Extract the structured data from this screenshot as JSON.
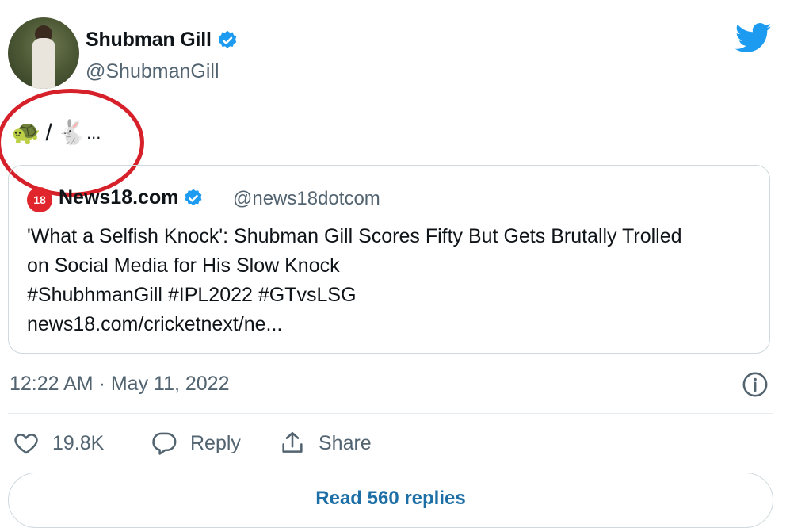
{
  "author": {
    "name": "Shubman Gill",
    "handle": "@ShubmanGill"
  },
  "tweet": {
    "emoji_turtle": "🐢",
    "slash": "/",
    "emoji_rabbit": "🐇",
    "ellipsis": "..."
  },
  "quoted": {
    "logo_text": "18",
    "name": "News18.com",
    "handle": "@news18dotcom",
    "lines": [
      "'What a Selfish Knock': Shubman Gill Scores Fifty But Gets Brutally Trolled",
      "on Social Media for His Slow Knock",
      "#ShubhmanGill #IPL2022 #GTvsLSG",
      "news18.com/cricketnext/ne..."
    ]
  },
  "meta": {
    "timestamp": "12:22 AM · May 11, 2022"
  },
  "actions": {
    "likes": "19.8K",
    "reply_label": "Reply",
    "share_label": "Share"
  },
  "read_replies": "Read 560 replies",
  "colors": {
    "accent": "#1d9bf0",
    "link": "#1d6fa5",
    "annotation_red": "#d6202a"
  }
}
